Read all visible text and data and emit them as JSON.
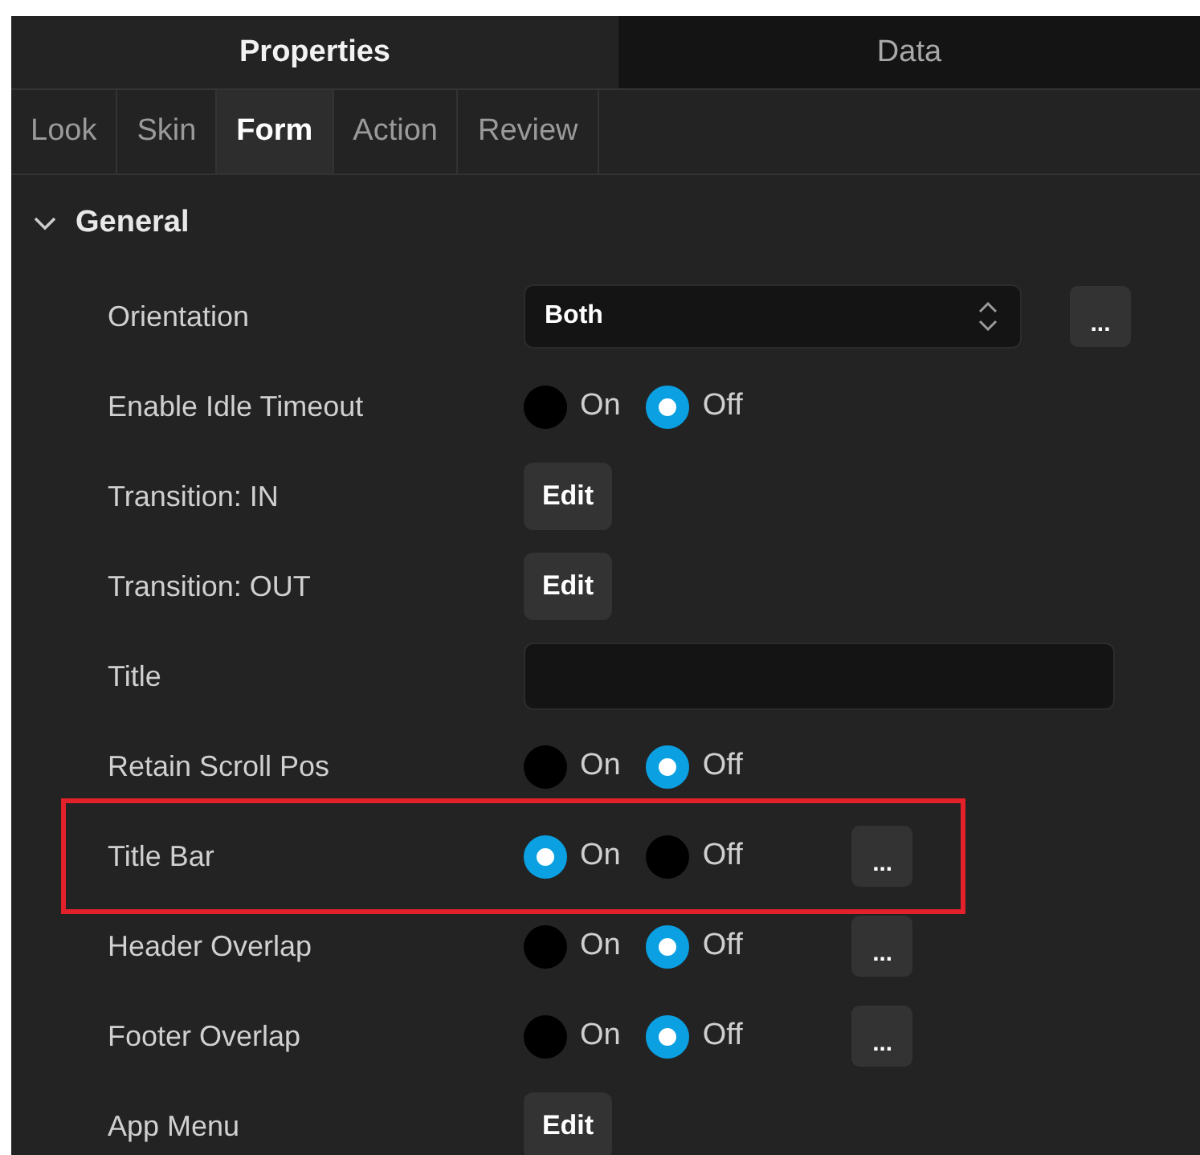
{
  "top_tabs": [
    {
      "label": "Properties",
      "selected": true
    },
    {
      "label": "Data",
      "selected": false
    }
  ],
  "sub_tabs": [
    {
      "label": "Look",
      "selected": false
    },
    {
      "label": "Skin",
      "selected": false
    },
    {
      "label": "Form",
      "selected": true
    },
    {
      "label": "Action",
      "selected": false
    },
    {
      "label": "Review",
      "selected": false
    }
  ],
  "section": {
    "title": "General",
    "expanded": true
  },
  "rows": [
    {
      "label": "Orientation",
      "kind": "select",
      "value": "Both",
      "more": "...",
      "highlighted": false
    },
    {
      "label": "Enable Idle Timeout",
      "kind": "radio",
      "options": [
        {
          "label": "On",
          "selected": false
        },
        {
          "label": "Off",
          "selected": true
        }
      ],
      "highlighted": false
    },
    {
      "label": "Transition: IN",
      "kind": "button",
      "button": "Edit",
      "highlighted": false
    },
    {
      "label": "Transition: OUT",
      "kind": "button",
      "button": "Edit",
      "highlighted": false
    },
    {
      "label": "Title",
      "kind": "text",
      "highlighted": false
    },
    {
      "label": "Retain Scroll Pos",
      "kind": "radio",
      "options": [
        {
          "label": "On",
          "selected": false
        },
        {
          "label": "Off",
          "selected": true
        }
      ],
      "highlighted": false
    },
    {
      "label": "Title Bar",
      "kind": "radio",
      "options": [
        {
          "label": "On",
          "selected": true
        },
        {
          "label": "Off",
          "selected": false
        }
      ],
      "more": "...",
      "highlighted": true
    },
    {
      "label": "Header Overlap",
      "kind": "radio",
      "options": [
        {
          "label": "On",
          "selected": false
        },
        {
          "label": "Off",
          "selected": true
        }
      ],
      "more": "...",
      "highlighted": false
    },
    {
      "label": "Footer Overlap",
      "kind": "radio",
      "options": [
        {
          "label": "On",
          "selected": false
        },
        {
          "label": "Off",
          "selected": true
        }
      ],
      "more": "...",
      "highlighted": false
    },
    {
      "label": "App Menu",
      "kind": "button",
      "button": "Edit",
      "highlighted": false
    }
  ]
}
